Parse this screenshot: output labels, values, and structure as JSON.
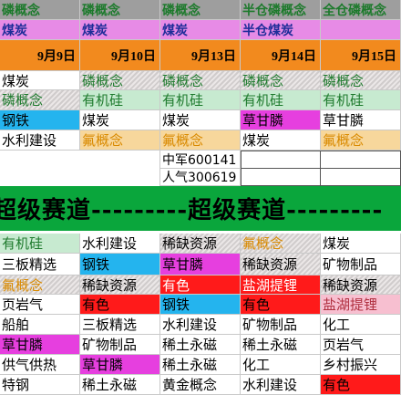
{
  "header": {
    "row1": [
      "磷概念",
      "磷概念",
      "磷概念",
      "半仓磷概念",
      "全仓磷概念"
    ],
    "row2": [
      "煤炭",
      "煤炭",
      "煤炭",
      "半仓煤炭",
      ""
    ],
    "dates": [
      "9月9日",
      "9月10日",
      "9月13日",
      "9月14日",
      "9月15日"
    ]
  },
  "upper": {
    "r1": [
      "煤炭",
      "磷概念",
      "磷概念",
      "磷概念",
      "磷概念"
    ],
    "r2": [
      "磷概念",
      "有机硅",
      "有机硅",
      "有机硅",
      "有机硅"
    ],
    "r3": [
      "钢铁",
      "煤炭",
      "煤炭",
      "草甘膦",
      "草甘膦"
    ],
    "r4": [
      "水利建设",
      "氟概念",
      "氟概念",
      "煤炭",
      "氟概念"
    ],
    "r5": [
      "",
      "",
      "中军600141",
      "",
      ""
    ],
    "r6": [
      "",
      "",
      "人气300619",
      "",
      ""
    ]
  },
  "banner": {
    "text": "超级赛道---------超级赛道---------"
  },
  "lower": {
    "r1": [
      "有机硅",
      "水利建设",
      "稀缺资源",
      "氟概念",
      "煤炭"
    ],
    "r2": [
      "三板精选",
      "钢铁",
      "草甘膦",
      "稀缺资源",
      "矿物制品"
    ],
    "r3": [
      "氟概念",
      "稀缺资源",
      "有色",
      "盐湖提锂",
      "稀缺资源"
    ],
    "r4": [
      "页岩气",
      "有色",
      "钢铁",
      "有色",
      "盐湖提锂"
    ],
    "r5": [
      "船舶",
      "三板精选",
      "水利建设",
      "矿物制品",
      "化工"
    ],
    "r6": [
      "草甘膦",
      "矿物制品",
      "稀土永磁",
      "稀土永磁",
      "页岩气"
    ],
    "r7": [
      "供气供热",
      "草甘膦",
      "稀土永磁",
      "化工",
      "乡村振兴"
    ],
    "r8": [
      "特钢",
      "稀土永磁",
      "黄金概念",
      "水利建设",
      "有色"
    ]
  }
}
